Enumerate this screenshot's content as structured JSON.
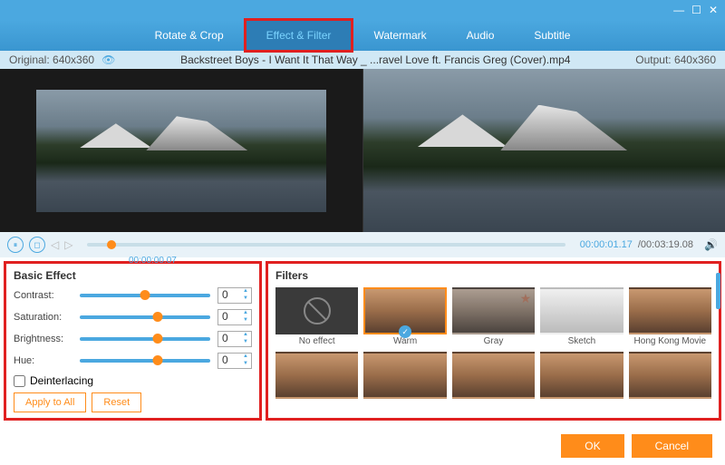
{
  "window": {
    "minimize": "—",
    "maximize": "☐",
    "close": "✕"
  },
  "tabs": {
    "rotate": "Rotate & Crop",
    "effect": "Effect & Filter",
    "watermark": "Watermark",
    "audio": "Audio",
    "subtitle": "Subtitle"
  },
  "infobar": {
    "original_label": "Original: 640x360",
    "file": "Backstreet Boys - I Want It That Way _ ...ravel Love ft. Francis Greg (Cover).mp4",
    "output_label": "Output: 640x360"
  },
  "playback": {
    "elapsed_below": "00:00:00.07",
    "current": "00:00:01.17",
    "total": "/00:03:19.08"
  },
  "basic": {
    "title": "Basic Effect",
    "contrast": {
      "label": "Contrast:",
      "value": "0"
    },
    "saturation": {
      "label": "Saturation:",
      "value": "0"
    },
    "brightness": {
      "label": "Brightness:",
      "value": "0"
    },
    "hue": {
      "label": "Hue:",
      "value": "0"
    },
    "deinterlacing": "Deinterlacing",
    "apply": "Apply to All",
    "reset": "Reset"
  },
  "filters": {
    "title": "Filters",
    "items": [
      {
        "label": "No effect"
      },
      {
        "label": "Warm"
      },
      {
        "label": "Gray"
      },
      {
        "label": "Sketch"
      },
      {
        "label": "Hong Kong Movie"
      },
      {
        "label": ""
      },
      {
        "label": ""
      },
      {
        "label": ""
      },
      {
        "label": ""
      },
      {
        "label": ""
      }
    ]
  },
  "footer": {
    "ok": "OK",
    "cancel": "Cancel"
  }
}
